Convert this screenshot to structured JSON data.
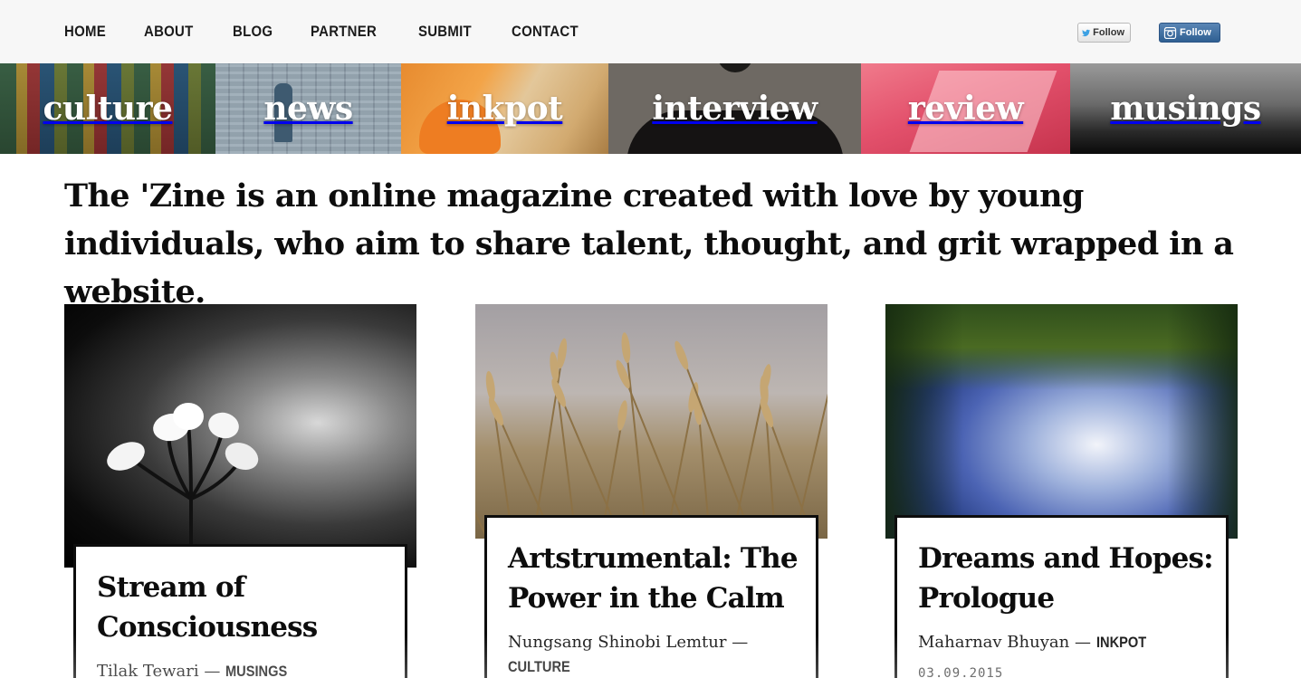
{
  "nav": {
    "items": [
      "HOME",
      "ABOUT",
      "BLOG",
      "PARTNER",
      "SUBMIT",
      "CONTACT"
    ]
  },
  "social": {
    "twitter_label": "Follow",
    "instagram_label": "Follow",
    "twitter_icon": "twitter-bird-icon",
    "instagram_icon": "instagram-camera-icon"
  },
  "categories": [
    "culture",
    "news",
    "inkpot",
    "interview",
    "review",
    "musings"
  ],
  "tagline": "The 'Zine is an online magazine created with love by young individuals, who aim to share talent, thought, and grit wrapped in a website.",
  "posts": [
    {
      "title": "Stream of Consciousness",
      "author": "Tilak Tewari",
      "separator": "—",
      "category": "MUSINGS",
      "date": ""
    },
    {
      "title": "Artstrumental: The Power in the Calm",
      "author": "Nungsang Shinobi Lemtur",
      "separator": "—",
      "category": "CULTURE",
      "date": ""
    },
    {
      "title": "Dreams and Hopes: Prologue",
      "author": "Maharnav Bhuyan",
      "separator": "—",
      "category": "INKPOT",
      "date": "03.09.2015"
    }
  ],
  "colors": {
    "nav_bg": "#f7f7f7",
    "text": "#0d0d0d",
    "instagram_button": "#3a6a9c",
    "review_tint": "#e3516c"
  }
}
